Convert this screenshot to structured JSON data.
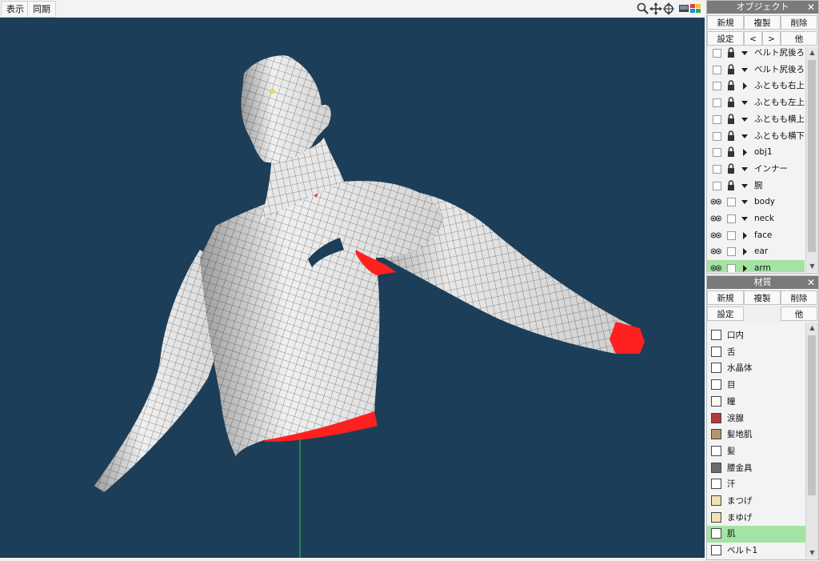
{
  "menu": {
    "display": "表示",
    "sync": "同期"
  },
  "view_tools": [
    "zoom-icon",
    "move-icon",
    "rotate-icon",
    "screen-icon"
  ],
  "object_panel": {
    "title": "オブジェクト",
    "close": "✕",
    "buttons": {
      "new": "新規",
      "duplicate": "複製",
      "delete": "削除",
      "settings": "設定",
      "prev": "<",
      "next": ">",
      "other": "他"
    },
    "items": [
      {
        "label": "ベルト尻後ろ上",
        "visible": false,
        "locked": true,
        "expanded": true
      },
      {
        "label": "ベルト尻後ろ連",
        "visible": false,
        "locked": true,
        "expanded": true
      },
      {
        "label": "ふともも右上前",
        "visible": false,
        "locked": true,
        "expanded": false
      },
      {
        "label": "ふともも左上後",
        "visible": false,
        "locked": true,
        "expanded": true
      },
      {
        "label": "ふともも横上",
        "visible": false,
        "locked": true,
        "expanded": true
      },
      {
        "label": "ふともも横下",
        "visible": false,
        "locked": true,
        "expanded": true
      },
      {
        "label": "obj1",
        "visible": false,
        "locked": true,
        "expanded": false
      },
      {
        "label": "インナー",
        "visible": false,
        "locked": true,
        "expanded": true
      },
      {
        "label": "腕",
        "visible": false,
        "locked": true,
        "expanded": true
      },
      {
        "label": "body",
        "visible": true,
        "locked": false,
        "expanded": true
      },
      {
        "label": "neck",
        "visible": true,
        "locked": false,
        "expanded": true
      },
      {
        "label": "face",
        "visible": true,
        "locked": false,
        "expanded": false
      },
      {
        "label": "ear",
        "visible": true,
        "locked": false,
        "expanded": false
      },
      {
        "label": "arm",
        "visible": true,
        "locked": false,
        "expanded": false,
        "selected": true
      }
    ]
  },
  "material_panel": {
    "title": "材質",
    "close": "✕",
    "buttons": {
      "new": "新規",
      "duplicate": "複製",
      "delete": "削除",
      "settings": "設定",
      "other": "他"
    },
    "items": [
      {
        "label": "口内",
        "color": "#ffffff"
      },
      {
        "label": "舌",
        "color": "#ffffff"
      },
      {
        "label": "水晶体",
        "color": "#ffffff"
      },
      {
        "label": "目",
        "color": "#ffffff"
      },
      {
        "label": "瞳",
        "color": "#fffaf0"
      },
      {
        "label": "涙腺",
        "color": "#b5393b"
      },
      {
        "label": "髪地肌",
        "color": "#b59668"
      },
      {
        "label": "髪",
        "color": "#ffffff"
      },
      {
        "label": "腰金具",
        "color": "#6b6b6b"
      },
      {
        "label": "汗",
        "color": "#ffffff"
      },
      {
        "label": "まつげ",
        "color": "#efe2b3"
      },
      {
        "label": "まゆげ",
        "color": "#efe2b3"
      },
      {
        "label": "肌",
        "color": "#ffffff",
        "selected": true
      },
      {
        "label": "ベルト1",
        "color": "#ffffff"
      }
    ]
  },
  "colors": {
    "viewport_bg": "#1d3e58",
    "mesh": "#f2f2f2",
    "highlight_red": "#ff2020",
    "selection": "#a5e3a5",
    "axis": "#2ecc40"
  }
}
